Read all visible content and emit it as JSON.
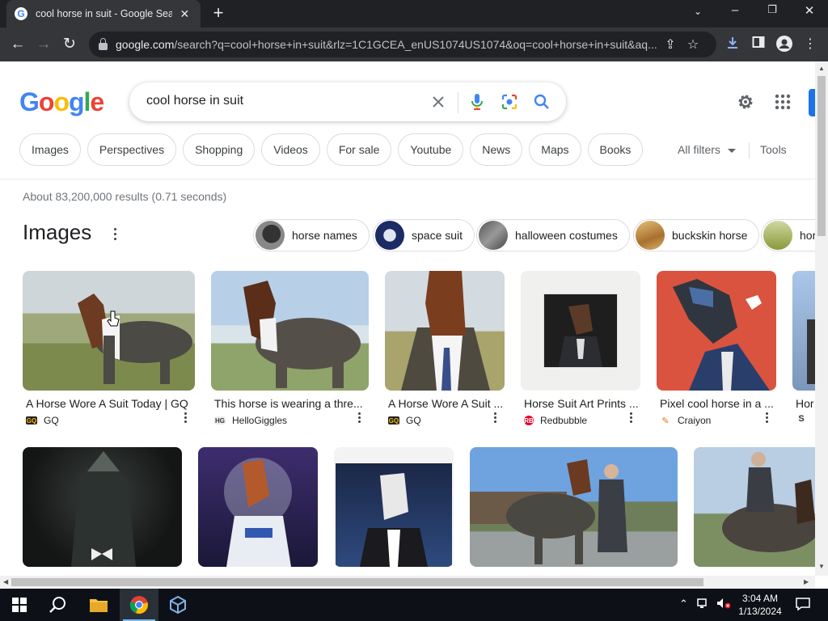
{
  "browser": {
    "tab_title": "cool horse in suit - Google Search",
    "tab_favicon": "G",
    "new_tab": "+",
    "url_domain": "google.com",
    "url_rest": "/search?q=cool+horse+in+suit&rlz=1C1GCEA_enUS1074US1074&oq=cool+horse+in+suit&aq..."
  },
  "search": {
    "query": "cool horse in suit"
  },
  "filters": {
    "chips": [
      "Images",
      "Perspectives",
      "Shopping",
      "Videos",
      "For sale",
      "Youtube",
      "News",
      "Maps",
      "Books"
    ],
    "all_filters": "All filters",
    "tools": "Tools"
  },
  "results": {
    "stats": "About 83,200,000 results (0.71 seconds)"
  },
  "images_section": {
    "heading": "Images",
    "refinements": [
      "horse names",
      "space suit",
      "halloween costumes",
      "buckskin horse",
      "hor"
    ],
    "cards": [
      {
        "title": "A Horse Wore A Suit Today | GQ",
        "source": "GQ",
        "source_icon": "GQ"
      },
      {
        "title": "This horse is wearing a thre...",
        "source": "HelloGiggles",
        "source_icon": "HG"
      },
      {
        "title": "A Horse Wore A Suit ...",
        "source": "GQ",
        "source_icon": "GQ"
      },
      {
        "title": "Horse Suit Art Prints ...",
        "source": "Redbubble",
        "source_icon": "RB"
      },
      {
        "title": "Pixel cool horse in a ...",
        "source": "Craiyon",
        "source_icon": "✎"
      },
      {
        "title": "Hor",
        "source": "",
        "source_icon": "S"
      }
    ]
  },
  "taskbar": {
    "time": "3:04 AM",
    "date": "1/13/2024"
  },
  "colors": {
    "google_blue": "#4285f4",
    "google_red": "#ea4335",
    "google_yellow": "#fbbc05",
    "google_green": "#34a853",
    "chrome_dark": "#202124",
    "accent_blue": "#1a73e8"
  },
  "icons": [
    "search-icon",
    "mic-icon",
    "lens-icon",
    "clear-icon",
    "gear-icon",
    "apps-icon",
    "star-icon",
    "download-icon",
    "profile-icon"
  ]
}
